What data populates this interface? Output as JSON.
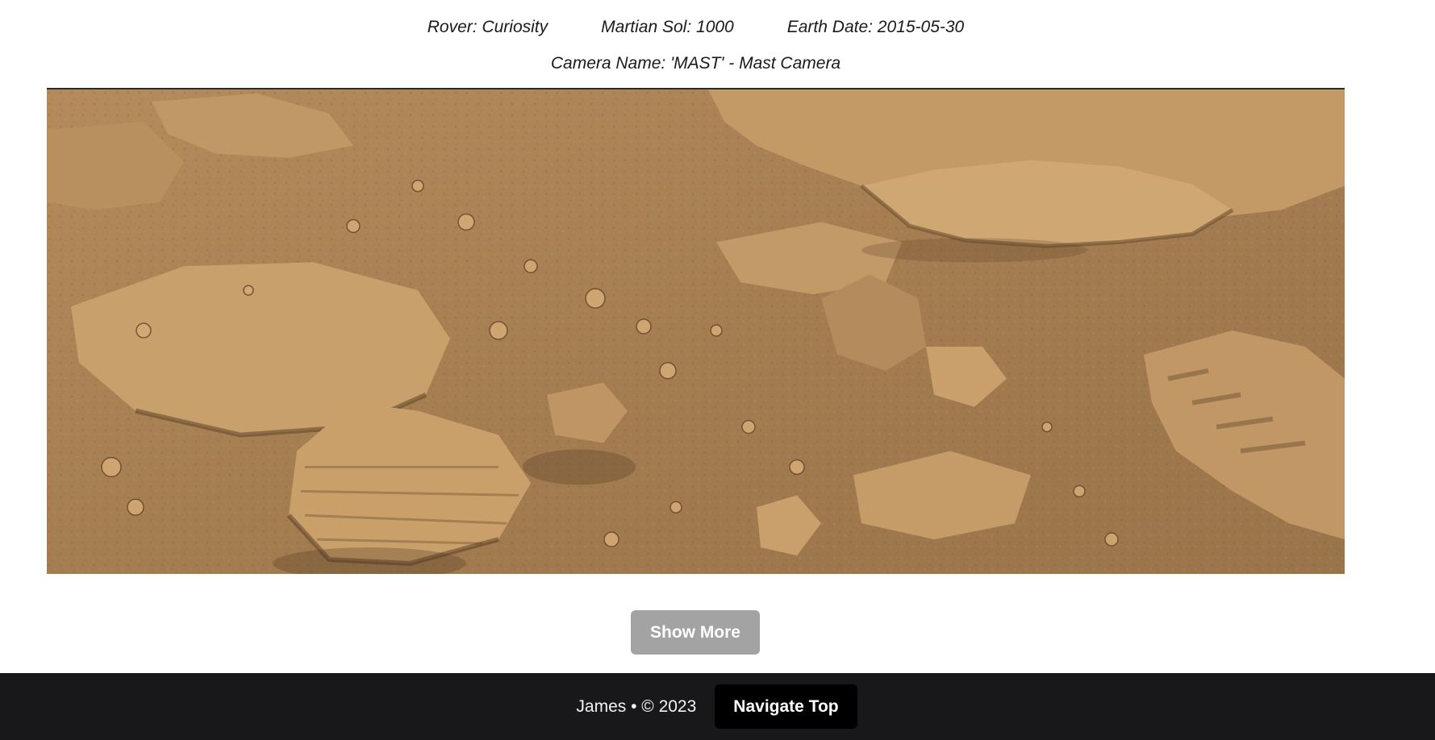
{
  "photo_info": {
    "rover": "Rover: Curiosity",
    "sol": "Martian Sol: 1000",
    "earth_date": "Earth Date: 2015-05-30",
    "camera": "Camera Name: 'MAST' - Mast Camera"
  },
  "actions": {
    "show_more_label": "Show More"
  },
  "footer": {
    "credit": "James • © 2023",
    "navigate_top_label": "Navigate Top"
  },
  "colors": {
    "terrain_base": "#a67f52",
    "terrain_light": "#c9a26d",
    "footer_bg": "#18181b",
    "show_more_bg": "#a3a3a3"
  }
}
